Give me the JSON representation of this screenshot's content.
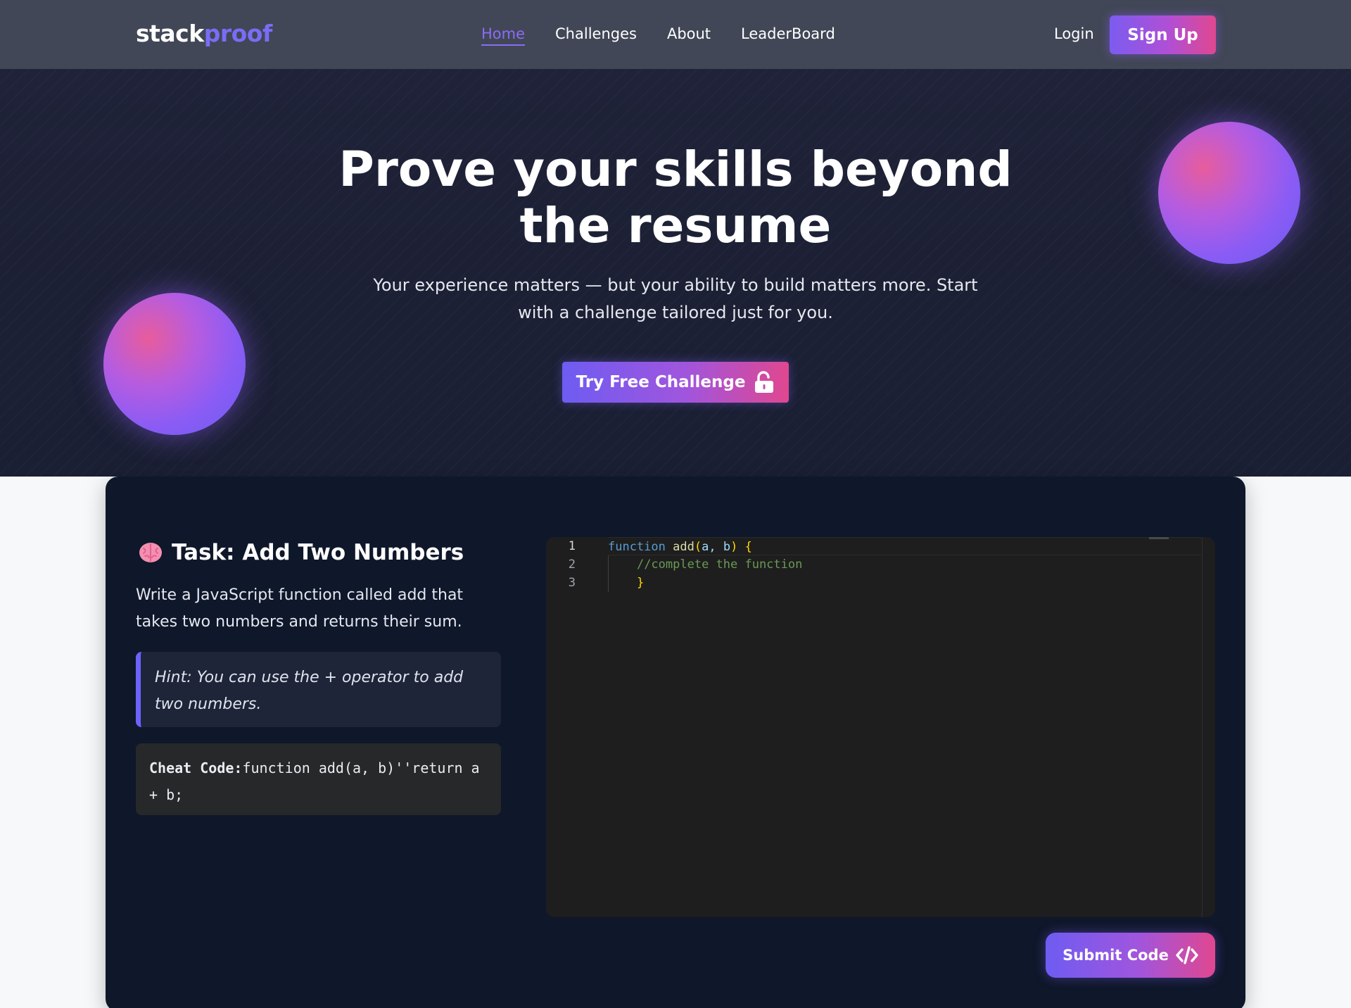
{
  "nav": {
    "brand_main": "stack",
    "brand_accent": "proof",
    "links": [
      "Home",
      "Challenges",
      "About",
      "LeaderBoard"
    ],
    "active_link": "Home",
    "login_label": "Login",
    "signup_label": "Sign Up"
  },
  "hero": {
    "title": "Prove your skills beyond the resume",
    "subtitle": "Your experience matters — but your ability to build matters more. Start with a challenge tailored just for you.",
    "cta_label": "Try Free Challenge",
    "cta_icon": "unlock-icon"
  },
  "task": {
    "icon": "brain-icon",
    "title": "Task: Add Two Numbers",
    "description": "Write a JavaScript function called add that takes two numbers and returns their sum.",
    "hint": "Hint: You can use the + operator to add two numbers.",
    "cheat_label": "Cheat Code:",
    "cheat_code": "function add(a, b)''return a + b;"
  },
  "editor": {
    "line_numbers": [
      "1",
      "2",
      "3"
    ],
    "line1_keyword": "function",
    "line1_name": "add",
    "line1_paren_open": "(",
    "line1_params": "a, b",
    "line1_paren_close": ")",
    "line1_brace": "{",
    "line2_comment": "//complete the function",
    "line3_brace": "}"
  },
  "submit": {
    "label": "Submit Code",
    "icon": "code-icon"
  },
  "colors": {
    "nav_bg": "#414756",
    "accent": "#7b6cf6",
    "hero_bg": "#1f2238",
    "card_bg": "#0f172a",
    "editor_bg": "#1e1e1e",
    "hint_border": "#6c63ff"
  }
}
